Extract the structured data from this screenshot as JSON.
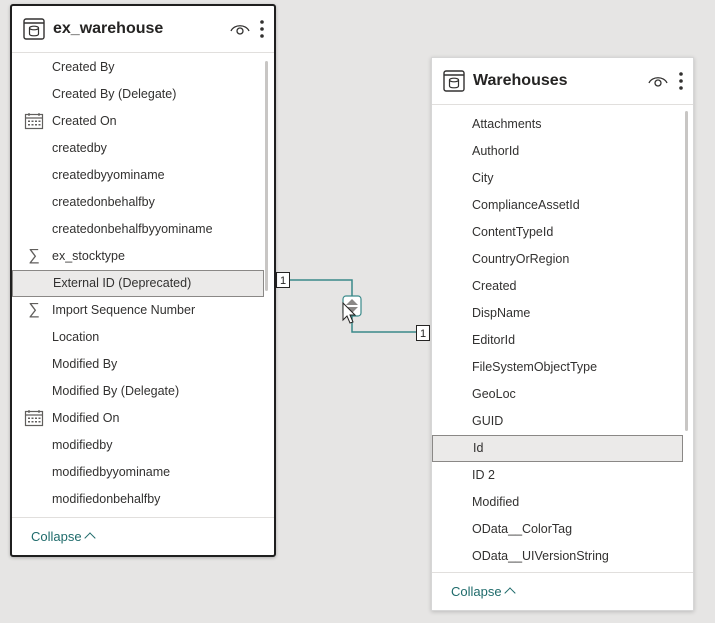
{
  "left_table": {
    "title": "ex_warehouse",
    "icons": {
      "table": "table-icon",
      "visibility": "eye-icon",
      "more": "more-options-icon"
    },
    "fields": [
      {
        "label": "Created By",
        "icon": ""
      },
      {
        "label": "Created By (Delegate)",
        "icon": ""
      },
      {
        "label": "Created On",
        "icon": "calendar-icon"
      },
      {
        "label": "createdby",
        "icon": ""
      },
      {
        "label": "createdbyyominame",
        "icon": ""
      },
      {
        "label": "createdonbehalfby",
        "icon": ""
      },
      {
        "label": "createdonbehalfbyyominame",
        "icon": ""
      },
      {
        "label": "ex_stocktype",
        "icon": "sigma-icon"
      },
      {
        "label": "External ID (Deprecated)",
        "icon": "",
        "selected": true
      },
      {
        "label": "Import Sequence Number",
        "icon": "sigma-icon"
      },
      {
        "label": "Location",
        "icon": ""
      },
      {
        "label": "Modified By",
        "icon": ""
      },
      {
        "label": "Modified By (Delegate)",
        "icon": ""
      },
      {
        "label": "Modified On",
        "icon": "calendar-icon"
      },
      {
        "label": "modifiedby",
        "icon": ""
      },
      {
        "label": "modifiedbyyominame",
        "icon": ""
      },
      {
        "label": "modifiedonbehalfby",
        "icon": ""
      }
    ],
    "collapse_label": "Collapse"
  },
  "right_table": {
    "title": "Warehouses",
    "icons": {
      "table": "table-icon",
      "visibility": "eye-icon",
      "more": "more-options-icon"
    },
    "fields": [
      {
        "label": "Attachments",
        "icon": ""
      },
      {
        "label": "AuthorId",
        "icon": ""
      },
      {
        "label": "City",
        "icon": ""
      },
      {
        "label": "ComplianceAssetId",
        "icon": ""
      },
      {
        "label": "ContentTypeId",
        "icon": ""
      },
      {
        "label": "CountryOrRegion",
        "icon": ""
      },
      {
        "label": "Created",
        "icon": ""
      },
      {
        "label": "DispName",
        "icon": ""
      },
      {
        "label": "EditorId",
        "icon": ""
      },
      {
        "label": "FileSystemObjectType",
        "icon": ""
      },
      {
        "label": "GeoLoc",
        "icon": ""
      },
      {
        "label": "GUID",
        "icon": ""
      },
      {
        "label": "Id",
        "icon": "",
        "selected": true
      },
      {
        "label": "ID 2",
        "icon": ""
      },
      {
        "label": "Modified",
        "icon": ""
      },
      {
        "label": "OData__ColorTag",
        "icon": ""
      },
      {
        "label": "OData__UIVersionString",
        "icon": ""
      }
    ],
    "collapse_label": "Collapse"
  },
  "relationship": {
    "from_cardinality": "1",
    "to_cardinality": "1",
    "cross_filter_icon": "bidirectional-filter-icon",
    "line_color": "#3a8a8a"
  },
  "colors": {
    "accent": "#1f6b6b",
    "selected_row": "#ebeae9",
    "canvas": "#e6e5e4"
  }
}
